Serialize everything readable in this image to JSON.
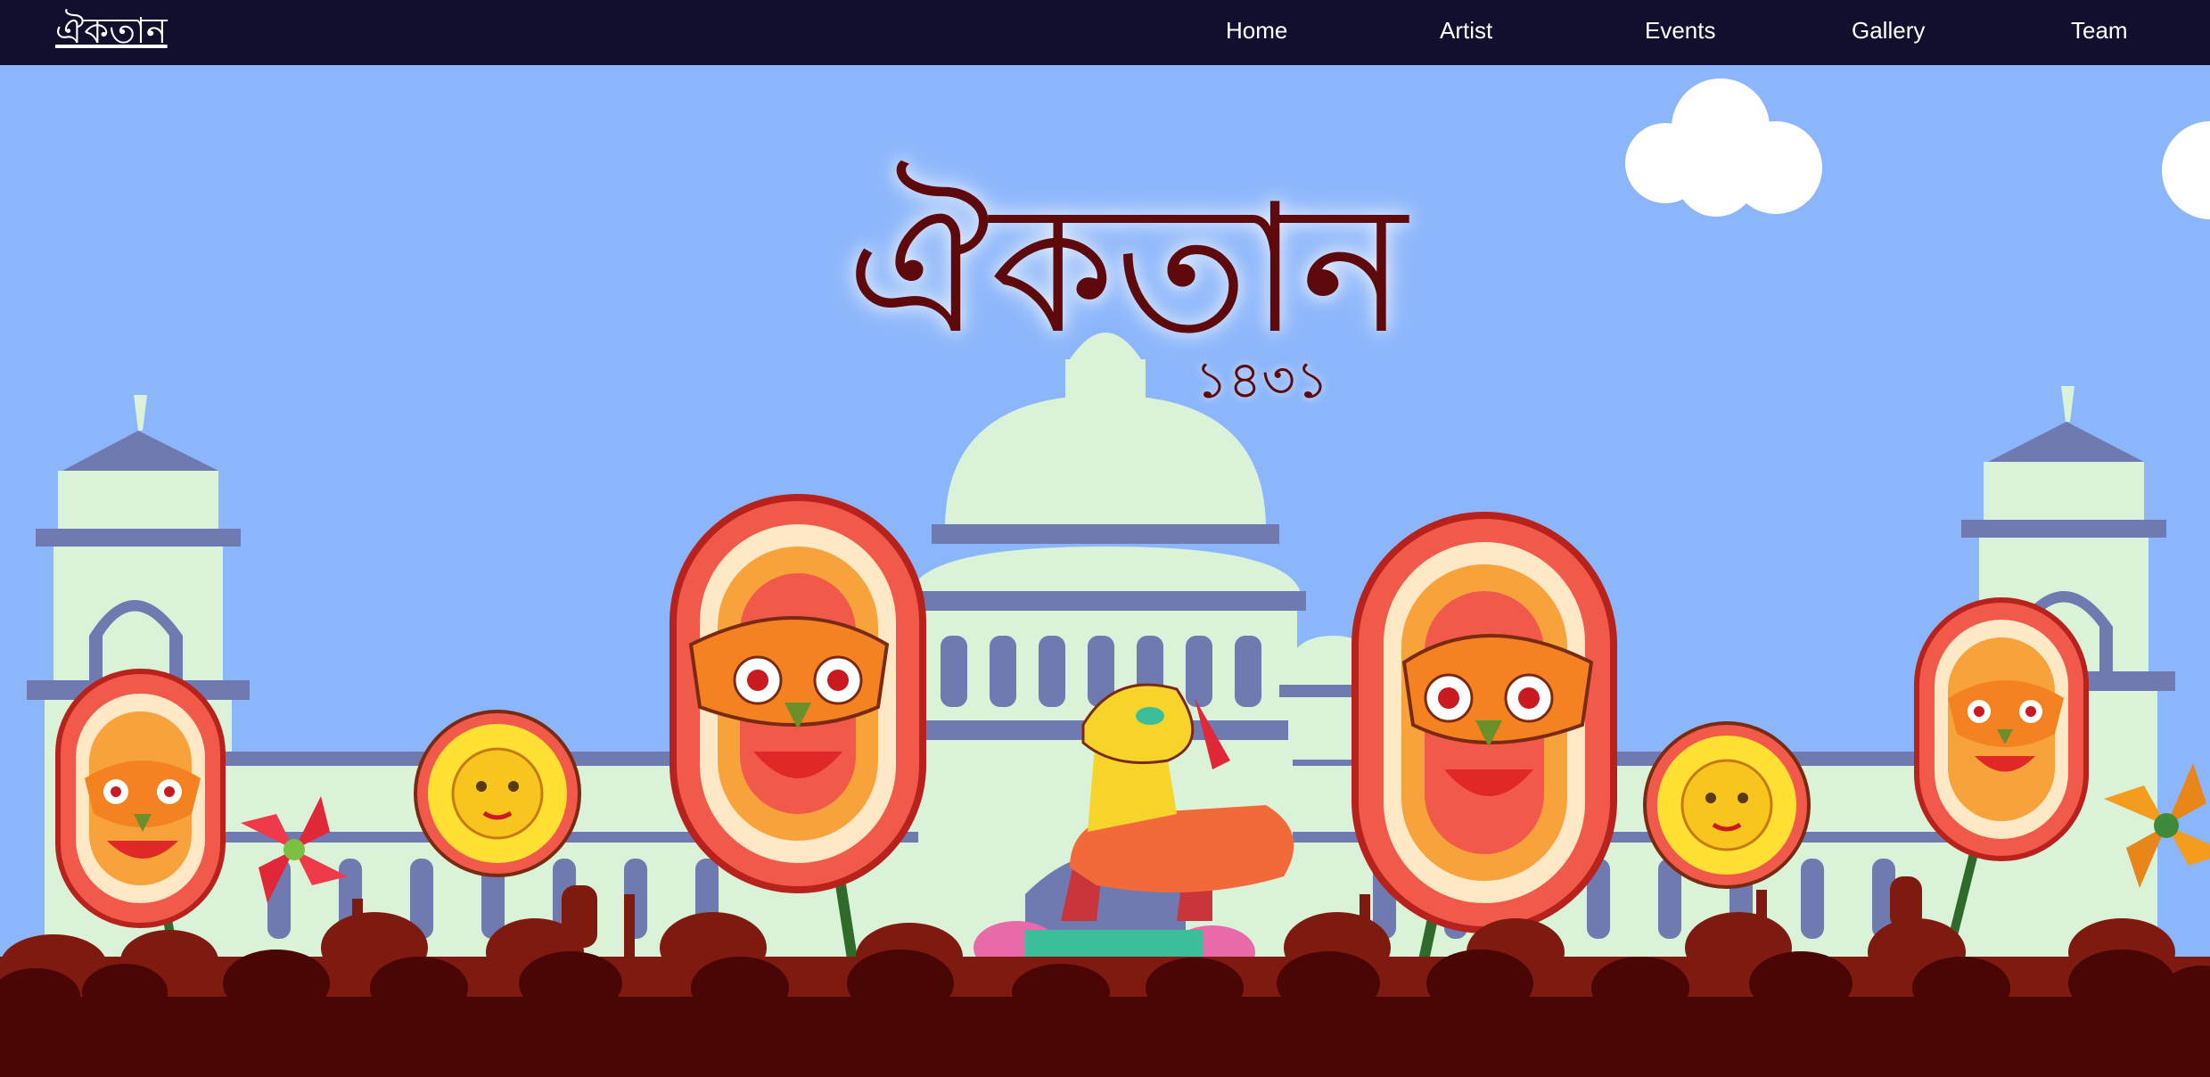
{
  "nav": {
    "logo_text": "ঐকতান",
    "links": [
      "Home",
      "Artist",
      "Events",
      "Gallery",
      "Team"
    ]
  },
  "hero": {
    "title": "ঐকতান",
    "year": "১৪৩১"
  },
  "colors": {
    "navbar_bg": "#110f2e",
    "sky": "#8cb6fb",
    "building": "#d9f2d8",
    "building_shade": "#6e7ab0",
    "title": "#5e0a0c",
    "crowd_front": "#4a0505",
    "crowd_back": "#7e1a10"
  }
}
